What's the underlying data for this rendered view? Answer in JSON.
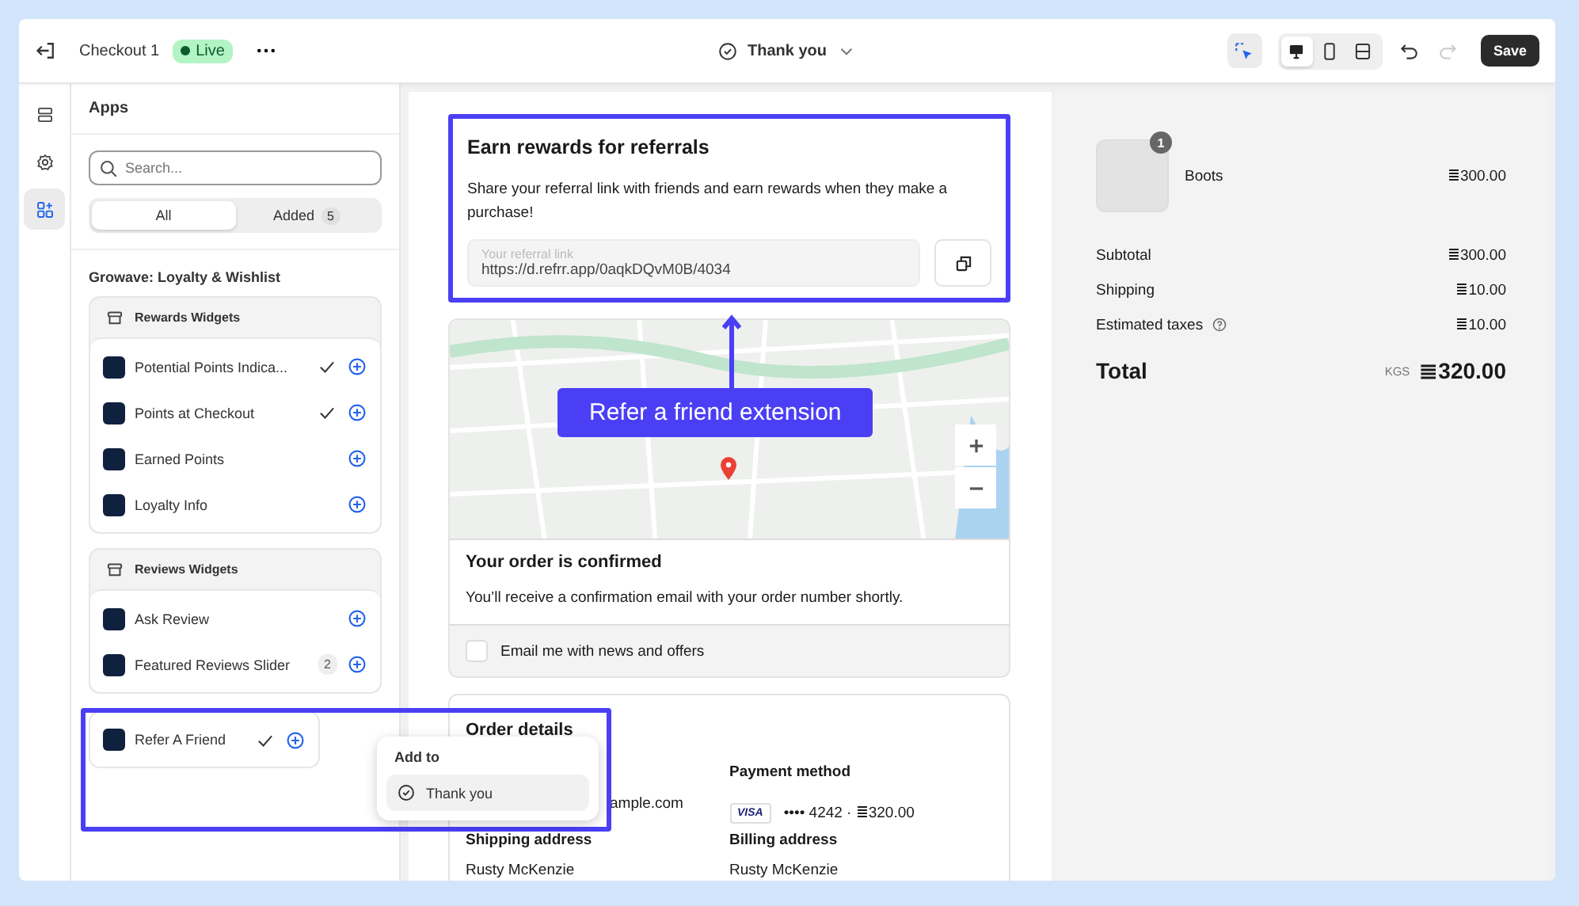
{
  "topbar": {
    "title": "Checkout 1",
    "status": "Live",
    "page": "Thank you",
    "save": "Save",
    "views": [
      {
        "kind": "desktop",
        "selected": true
      },
      {
        "kind": "mobile",
        "selected": false
      },
      {
        "kind": "fullwidth",
        "selected": false
      }
    ]
  },
  "rail": [
    {
      "kind": "sections",
      "selected": false
    },
    {
      "kind": "settings",
      "selected": false
    },
    {
      "kind": "apps",
      "selected": true
    }
  ],
  "apps": {
    "title": "Apps",
    "search_placeholder": "Search...",
    "tabs": [
      {
        "label": "All",
        "selected": true
      },
      {
        "label": "Added",
        "count": "5",
        "selected": false
      }
    ],
    "app_name": "Growave: Loyalty & Wishlist",
    "groups": [
      {
        "title": "Rewards Widgets",
        "items": [
          {
            "label": "Potential Points Indica...",
            "added": true
          },
          {
            "label": "Points at Checkout",
            "added": true
          },
          {
            "label": "Earned Points",
            "added": false
          },
          {
            "label": "Loyalty Info",
            "added": false
          }
        ]
      },
      {
        "title": "Reviews Widgets",
        "items": [
          {
            "label": "Ask Review",
            "added": false
          },
          {
            "label": "Featured Reviews Slider",
            "count": "2",
            "added": false
          }
        ]
      }
    ],
    "standalone": [
      {
        "label": "Refer A Friend",
        "added": true
      }
    ]
  },
  "popup": {
    "title": "Add to",
    "option": "Thank you"
  },
  "annotation": {
    "label": "Refer a friend extension"
  },
  "referral": {
    "title": "Earn rewards for referrals",
    "text": "Share your referral link with friends and earn rewards when they make a purchase!",
    "field_label": "Your referral link",
    "link": "https://d.refrr.app/0aqkDQvM0B/4034"
  },
  "confirmation": {
    "title": "Your order is confirmed",
    "text": "You’ll receive a confirmation email with your order number shortly.",
    "newsletter": {
      "label": "Email me with news and offers",
      "checked": false
    }
  },
  "order_details": {
    "title": "Order details",
    "email": "ample.com",
    "shipping_heading": "Shipping address",
    "shipping_name": "Rusty McKenzie",
    "payment_heading": "Payment method",
    "card_brand": "VISA",
    "card": "•••• 4242 · ≣320.00",
    "billing_heading": "Billing address",
    "billing_name": "Rusty McKenzie"
  },
  "summary": {
    "item": {
      "name": "Boots",
      "quantity": "1",
      "price": "≣300.00"
    },
    "lines": [
      {
        "label": "Subtotal",
        "value": "≣300.00",
        "info": false
      },
      {
        "label": "Shipping",
        "value": "≣10.00",
        "info": false
      },
      {
        "label": "Estimated taxes",
        "value": "≣10.00",
        "info": true
      }
    ],
    "total": {
      "label": "Total",
      "currency": "KGS",
      "value": "≣320.00"
    }
  }
}
